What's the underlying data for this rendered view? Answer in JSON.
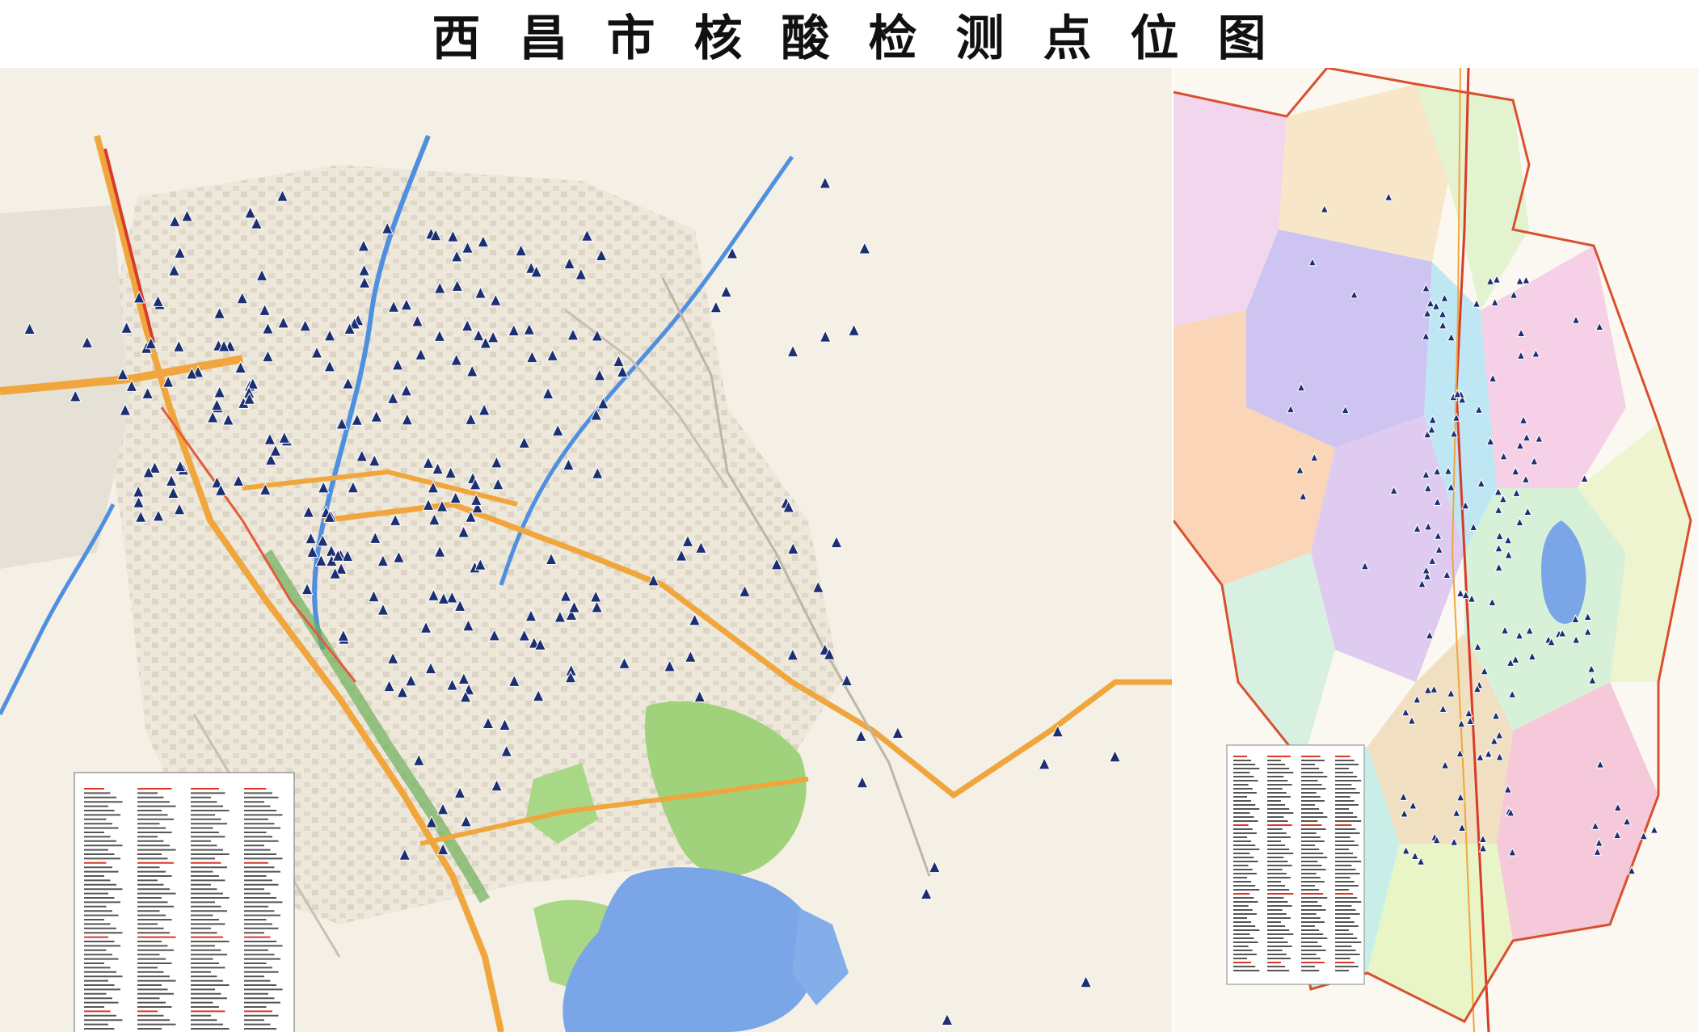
{
  "title": "西昌市核酸检测点位图",
  "colors": {
    "marker": "#1c2f73",
    "road_major": "#f0a63c",
    "road_red": "#d93a2b",
    "river": "#4f8fe0",
    "lake": "#7aa6e8",
    "park": "#9fd27a",
    "boundary": "#d9502e",
    "land": "#f4f0e6"
  },
  "icons": {
    "marker": "testing-site-tent-icon"
  }
}
